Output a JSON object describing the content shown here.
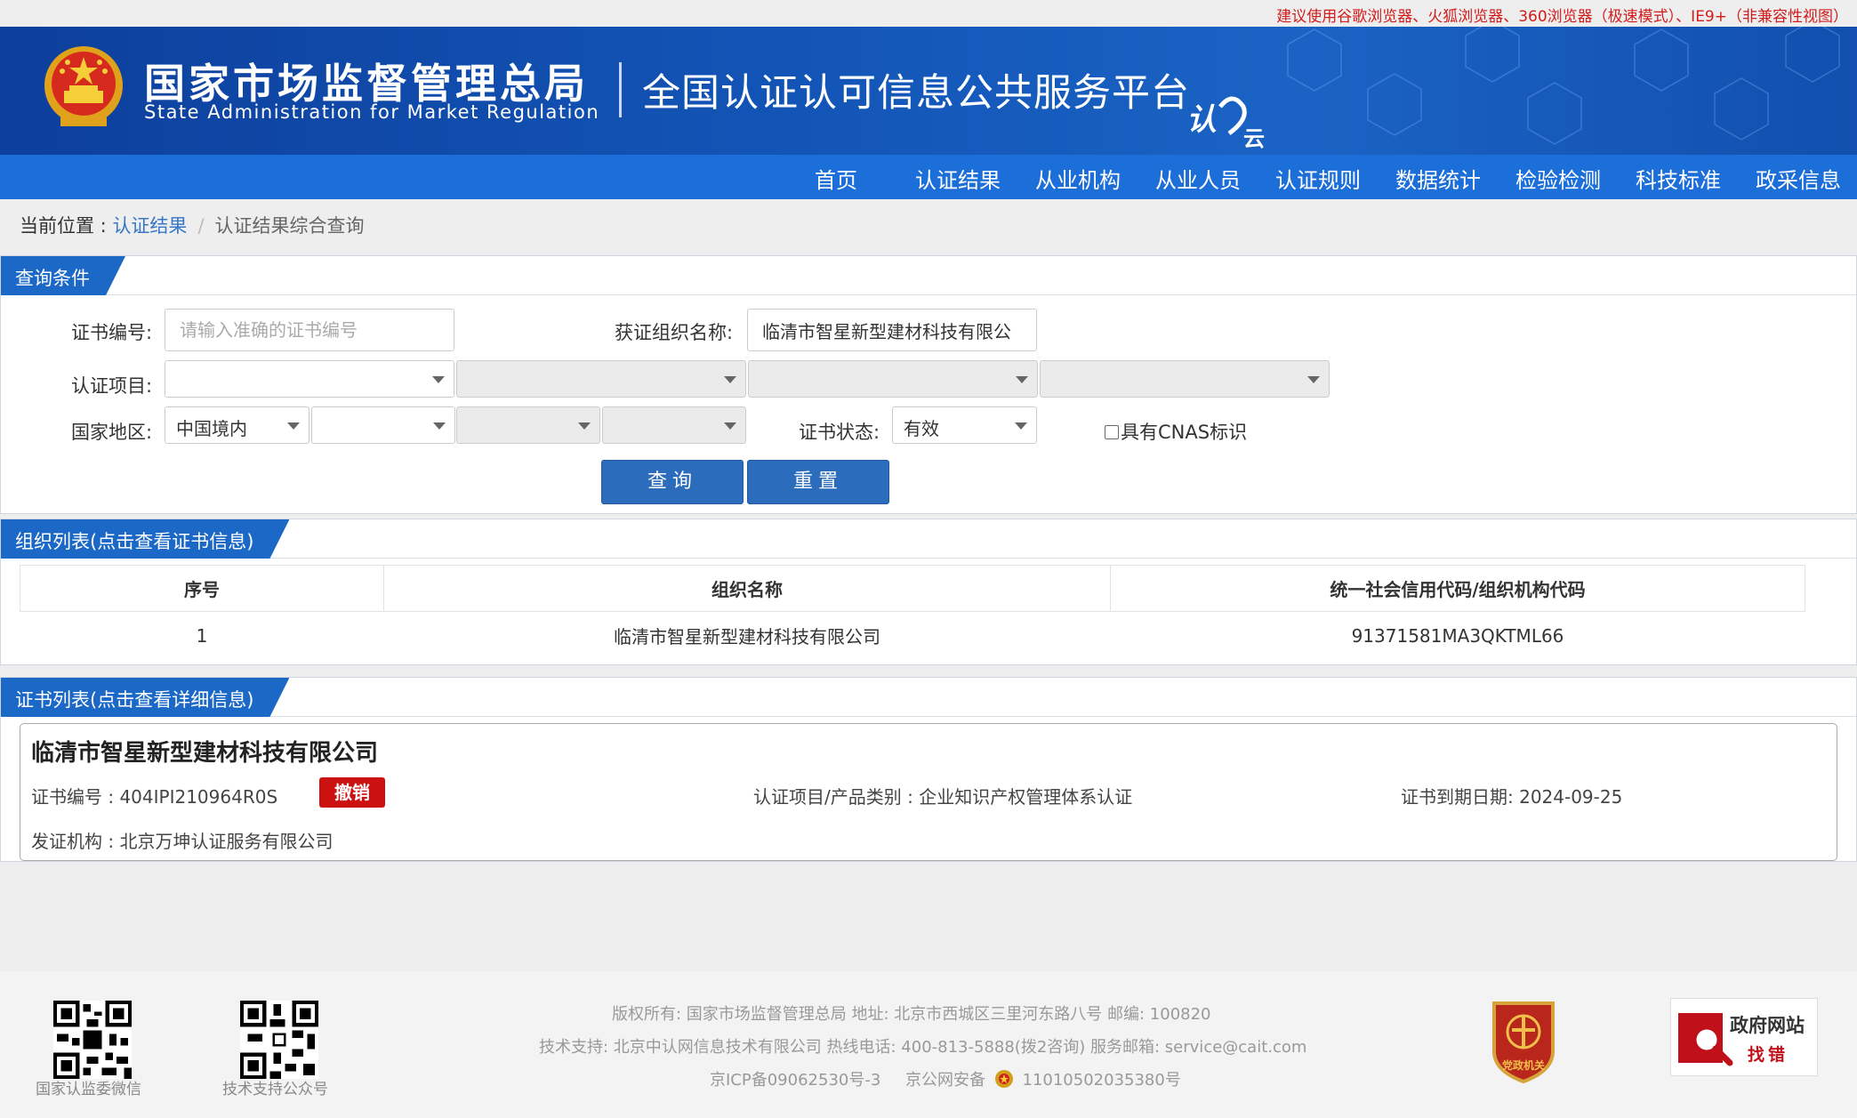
{
  "notice": "建议使用谷歌浏览器、火狐浏览器、360浏览器（极速模式）、IE9+（非兼容性视图）",
  "header": {
    "agency_cn": "国家市场监督管理总局",
    "agency_en": "State Administration for Market Regulation",
    "platform": "全国认证认可信息公共服务平台",
    "logo_text": "认",
    "logo_sub": "云"
  },
  "nav": [
    "首页",
    "认证结果",
    "从业机构",
    "从业人员",
    "认证规则",
    "数据统计",
    "检验检测",
    "科技标准",
    "政采信息"
  ],
  "breadcrumb": {
    "label": "当前位置 : ",
    "link": "认证结果",
    "sep": "/",
    "current": "认证结果综合查询"
  },
  "query": {
    "title": "查询条件",
    "cert_no_label": "证书编号:",
    "cert_no_placeholder": "请输入准确的证书编号",
    "org_label": "获证组织名称:",
    "org_value": "临清市智星新型建材科技有限公",
    "project_label": "认证项目:",
    "region_label": "国家地区:",
    "region_value": "中国境内",
    "status_label": "证书状态:",
    "status_value": "有效",
    "cnas_label": "具有CNAS标识",
    "search_btn": "查询",
    "reset_btn": "重置"
  },
  "org_list": {
    "title": "组织列表(点击查看证书信息)",
    "columns": [
      "序号",
      "组织名称",
      "统一社会信用代码/组织机构代码"
    ],
    "rows": [
      [
        "1",
        "临清市智星新型建材科技有限公司",
        "91371581MA3QKTML66"
      ]
    ]
  },
  "cert_list": {
    "title": "证书列表(点击查看详细信息)",
    "company": "临清市智星新型建材科技有限公司",
    "cert_no": "证书编号 : 404IPI210964R0S",
    "status_badge": "撤销",
    "project": "认证项目/产品类别 : 企业知识产权管理体系认证",
    "expiry": "证书到期日期: 2024-09-25",
    "issuer": "发证机构 : 北京万坤认证服务有限公司"
  },
  "footer": {
    "qr1_caption": "国家认监委微信",
    "qr2_caption": "技术支持公众号",
    "line1": "版权所有:  国家市场监督管理总局    地址:  北京市西城区三里河东路八号    邮编:  100820",
    "line2": "技术支持:  北京中认网信息技术有限公司    热线电话:  400-813-5888(拨2咨询)    服务邮箱:  service@cait.com",
    "icp": "京ICP备09062530号-3",
    "police": "京公网安备",
    "police_no": "11010502035380号",
    "party_badge": "党政机关",
    "gov_title": "政府网站",
    "gov_sub": "找错"
  },
  "colors": {
    "banner": "#124fae",
    "nav": "#1c6ed8",
    "tab": "#1b68c7",
    "button": "#2c6cbc",
    "badge": "#cc1111",
    "notice": "#d21c1c"
  }
}
